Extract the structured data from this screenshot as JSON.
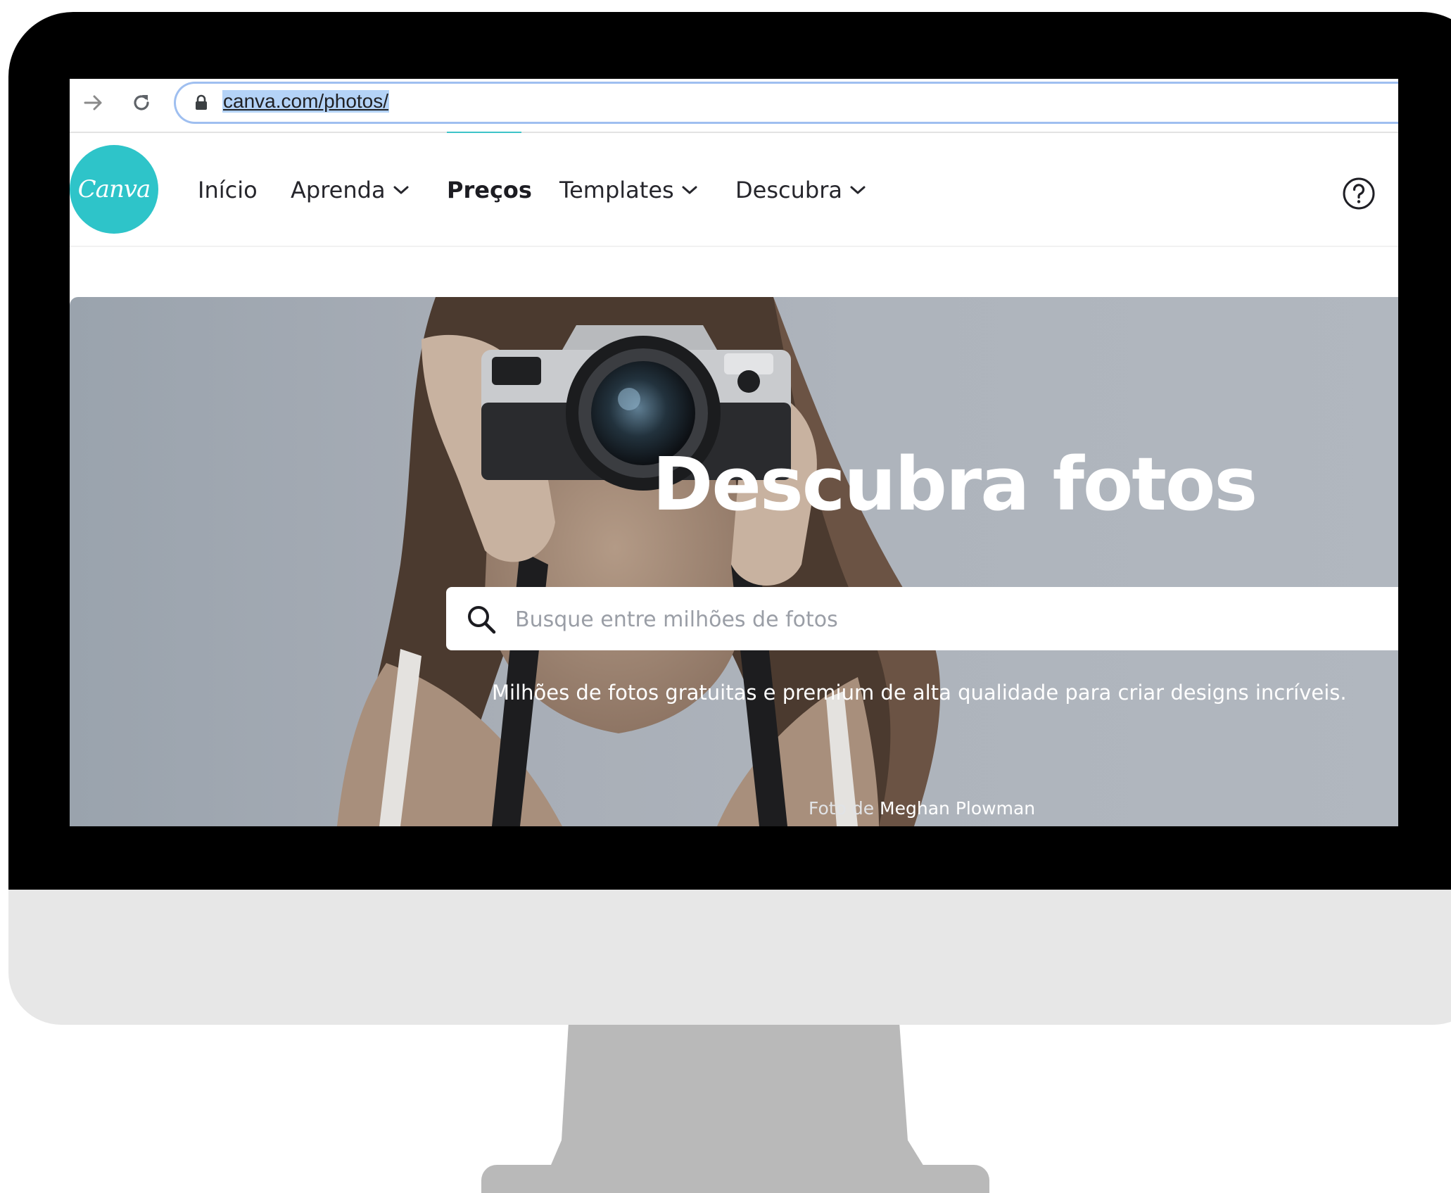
{
  "browser": {
    "url": "canva.com/photos/"
  },
  "nav": {
    "items": [
      {
        "label": "Início"
      },
      {
        "label": "Aprenda"
      },
      {
        "label": "Preços"
      },
      {
        "label": "Templates"
      },
      {
        "label": "Descubra"
      }
    ],
    "logo_text": "Canva"
  },
  "hero": {
    "title": "Descubra fotos",
    "search_placeholder": "Busque entre milhões de fotos",
    "subtitle": "Milhões de fotos gratuitas e premium de alta qualidade para criar designs incríveis.",
    "credit_prefix": "Foto de",
    "credit_name": "Meghan Plowman"
  },
  "colors": {
    "brand": "#2ec4c9",
    "bezel": "#000000",
    "chin": "#e7e7e7",
    "stand": "#b9b9b9"
  },
  "icons": [
    "forward-arrow-icon",
    "reload-icon",
    "lock-icon",
    "chevron-down-icon",
    "help-circle-icon",
    "search-icon"
  ]
}
